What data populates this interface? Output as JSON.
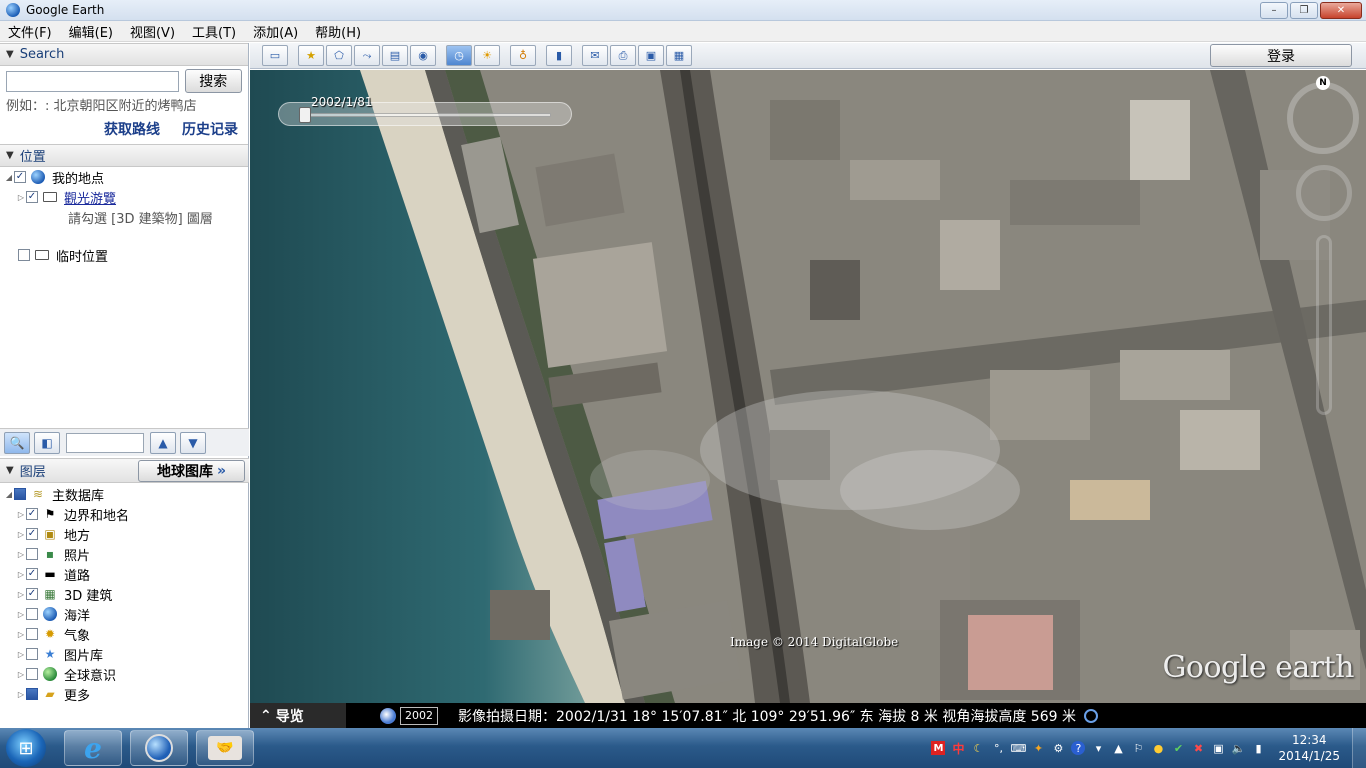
{
  "window": {
    "title": "Google Earth",
    "controls": [
      "–",
      "❐",
      "✕"
    ]
  },
  "menubar": {
    "items": [
      "文件(F)",
      "编辑(E)",
      "视图(V)",
      "工具(T)",
      "添加(A)",
      "帮助(H)"
    ]
  },
  "search_panel": {
    "header": "Search",
    "input_value": "",
    "button_label": "搜索",
    "example": "例如：: 北京朝阳区附近的烤鸭店",
    "get_directions": "获取路线",
    "history": "历史记录"
  },
  "places_panel": {
    "header": "位置",
    "items": [
      {
        "label": "我的地点"
      },
      {
        "label": "觀光游覽"
      },
      {
        "label": "請勾選 [3D 建築物] 圖層"
      },
      {
        "label": "临时位置"
      }
    ]
  },
  "layers_panel": {
    "header": "图层",
    "gallery_button": "地球图库",
    "gallery_arrow": "»",
    "items": [
      {
        "label": "主数据库",
        "checked": "part"
      },
      {
        "label": "边界和地名",
        "checked": "yes"
      },
      {
        "label": "地方",
        "checked": "yes"
      },
      {
        "label": "照片",
        "checked": "no"
      },
      {
        "label": "道路",
        "checked": "yes"
      },
      {
        "label": "3D 建筑",
        "checked": "yes"
      },
      {
        "label": "海洋",
        "checked": "no"
      },
      {
        "label": "气象",
        "checked": "no"
      },
      {
        "label": "图片库",
        "checked": "no"
      },
      {
        "label": "全球意识",
        "checked": "no"
      },
      {
        "label": "更多",
        "checked": "part"
      }
    ]
  },
  "map_toolbar": {
    "login": "登录"
  },
  "map": {
    "time_label": "2002/1/81",
    "copyright": "Image © 2014 DigitalGlobe",
    "logo": "Google earth",
    "compass_north": "N"
  },
  "statusbar": {
    "nav_toggle": "导览",
    "nav_arrow": "⌃",
    "year": "2002",
    "text": "影像拍摄日期：2002/1/31   18° 15′07.81″ 北 109° 29′51.96″ 东 海拔      8 米   视角海拔高度     569 米"
  },
  "taskbar": {
    "clock_time": "12:34",
    "clock_date": "2014/1/25",
    "ime_label": "中"
  }
}
